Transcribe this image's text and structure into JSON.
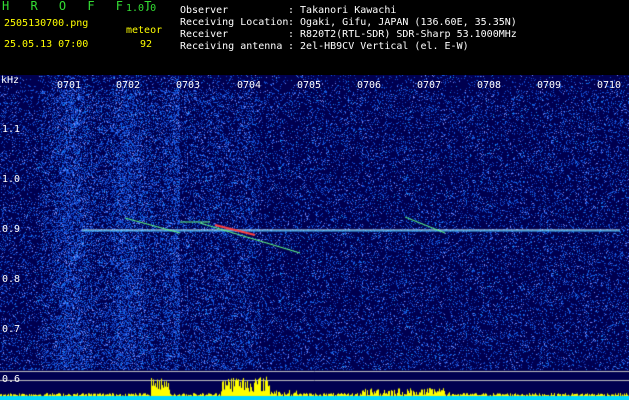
{
  "app": {
    "logo": "H R O F F T",
    "version": "1.0.0"
  },
  "file": {
    "name": "2505130700.png",
    "datetime": "25.05.13 07:00"
  },
  "meteor": {
    "label": "meteor",
    "count": "92"
  },
  "info": [
    {
      "label": "Observer",
      "value": ": Takanori Kawachi"
    },
    {
      "label": "Receiving Location",
      "value": ": Ogaki, Gifu, JAPAN (136.60E, 35.35N)"
    },
    {
      "label": "Receiver",
      "value": ": R820T2(RTL-SDR) SDR-Sharp 53.1000MHz"
    },
    {
      "label": "Receiving antenna",
      "value": ": 2el-HB9CV Vertical (el. E-W)"
    }
  ],
  "spectrogram": {
    "y_unit": "kHz",
    "y_ticks": [
      "1.1",
      "1.0",
      "0.9",
      "0.8",
      "0.7",
      "0.6"
    ],
    "x_ticks": [
      "0701",
      "0702",
      "0703",
      "0704",
      "0705",
      "0706",
      "0707",
      "0708",
      "0709",
      "0710"
    ],
    "carrier_khz": 0.9,
    "colors": {
      "background": "#000050",
      "noise": "#2040ff",
      "carrier": "#e0ffff",
      "echo": "#ff4040",
      "level": "#ffff00",
      "level_base": "#00d8ff"
    }
  }
}
